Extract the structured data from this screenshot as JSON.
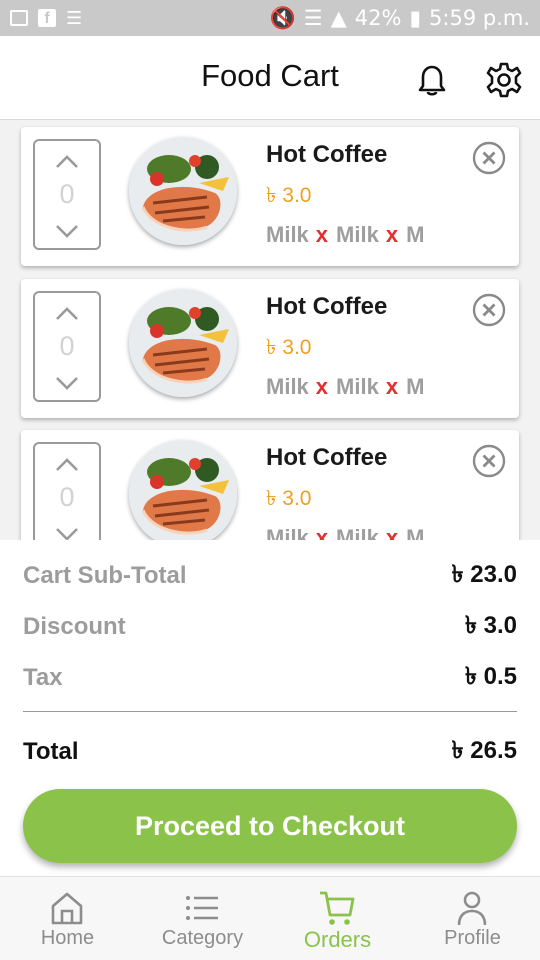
{
  "status_bar": {
    "battery": "42%",
    "time": "5:59 p.m.",
    "left_icons": [
      "image-icon",
      "facebook-icon",
      "list-icon"
    ],
    "right_icons": [
      "mute-icon",
      "wifi-icon",
      "signal-icon",
      "battery-icon"
    ]
  },
  "header": {
    "title": "Food Cart",
    "icons": [
      "bell-icon",
      "gear-icon"
    ]
  },
  "cart": {
    "items": [
      {
        "quantity": "0",
        "name": "Hot Coffee",
        "price": "৳ 3.0",
        "addon_1": "Milk",
        "addon_2": "Milk",
        "addon_3": "M",
        "remove_mark": "x"
      },
      {
        "quantity": "0",
        "name": "Hot Coffee",
        "price": "৳ 3.0",
        "addon_1": "Milk",
        "addon_2": "Milk",
        "addon_3": "M",
        "remove_mark": "x"
      },
      {
        "quantity": "0",
        "name": "Hot Coffee",
        "price": "৳ 3.0",
        "addon_1": "Milk",
        "addon_2": "Milk",
        "addon_3": "M",
        "remove_mark": "x"
      }
    ]
  },
  "summary": {
    "subtotal_label": "Cart Sub-Total",
    "subtotal_value": "৳ 23.0",
    "discount_label": "Discount",
    "discount_value": "৳ 3.0",
    "tax_label": "Tax",
    "tax_value": "৳ 0.5",
    "total_label": "Total",
    "total_value": "৳ 26.5"
  },
  "checkout_button": {
    "label": "Proceed to Checkout",
    "color": "#8bc34a"
  },
  "bottom_nav": {
    "items": [
      {
        "label": "Home",
        "icon": "home-icon"
      },
      {
        "label": "Category",
        "icon": "list-icon"
      },
      {
        "label": "Orders",
        "icon": "cart-icon",
        "active": true
      },
      {
        "label": "Profile",
        "icon": "person-icon"
      }
    ]
  },
  "colors": {
    "accent": "#8bc34a",
    "price": "#f0a020",
    "remove_x": "#e03030"
  }
}
